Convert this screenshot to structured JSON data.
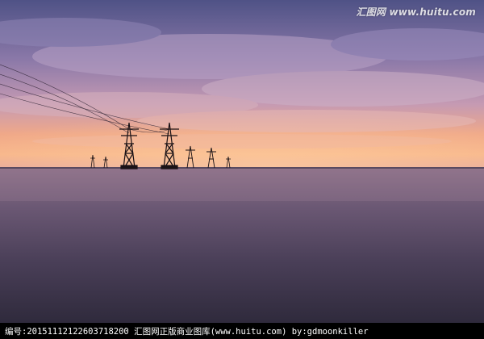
{
  "photo": {
    "subject": "transmission-towers-at-sunset",
    "colors": {
      "sky_top": "#5b5a8e",
      "sky_mid": "#a27fa8",
      "horizon_glow": "#f3a07a",
      "water": "#584a62",
      "water_dark": "#2e2838",
      "tower": "#1a1216"
    }
  },
  "watermark": {
    "text": "汇图网 www.huitu.com"
  },
  "caption": {
    "text": "编号:20151112122603718200   汇图网正版商业图库(www.huitu.com) by:gdmoonkiller"
  }
}
